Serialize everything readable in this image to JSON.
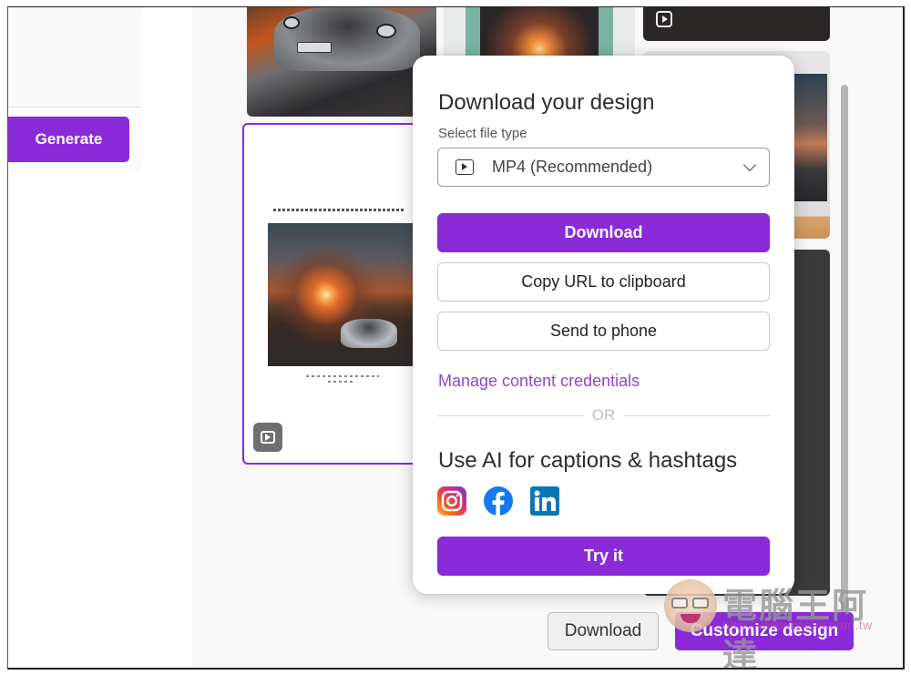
{
  "sidebar": {
    "generate_label": "Generate"
  },
  "popup": {
    "title": "Download your design",
    "file_type_label": "Select file type",
    "file_type_selected": "MP4 (Recommended)",
    "file_type_icon": "video-play-icon",
    "download_label": "Download",
    "copy_url_label": "Copy URL to clipboard",
    "send_to_phone_label": "Send to phone",
    "credentials_link": "Manage content credentials",
    "divider_text": "OR",
    "ai_title": "Use AI for captions & hashtags",
    "social_icons": [
      "instagram-icon",
      "facebook-icon",
      "linkedin-icon"
    ],
    "try_label": "Try it"
  },
  "footer": {
    "download_label": "Download",
    "customize_label": "Customize design"
  },
  "watermark": {
    "title": "電腦王阿達",
    "url": "http://www.kocpc.com.tw"
  },
  "colors": {
    "accent": "#8b2ad8",
    "link": "#9146cc"
  }
}
